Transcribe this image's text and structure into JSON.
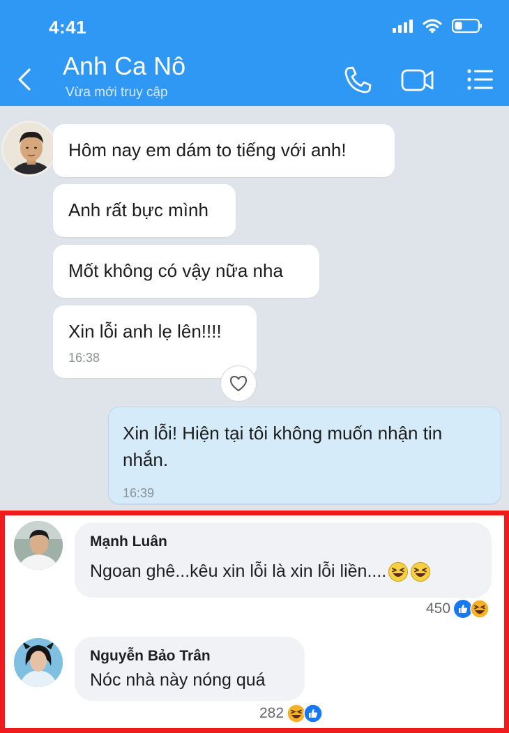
{
  "status_bar": {
    "time": "4:41"
  },
  "header": {
    "title": "Anh Ca Nô",
    "subtitle": "Vừa mới truy cập"
  },
  "messages": [
    {
      "from": "contact",
      "text": "Hôm nay em dám to tiếng với anh!"
    },
    {
      "from": "contact",
      "text": "Anh rất bực mình"
    },
    {
      "from": "contact",
      "text": "Mốt không có vậy nữa nha"
    },
    {
      "from": "contact",
      "text": "Xin lỗi anh lẹ lên!!!!",
      "time": "16:38"
    },
    {
      "from": "me",
      "text": "Xin lỗi! Hiện tại tôi không muốn nhận tin nhắn.",
      "time": "16:39"
    }
  ],
  "comments": [
    {
      "name": "Mạnh Luân",
      "text": "Ngoan ghê...kêu xin lỗi là xin lỗi liền....",
      "reaction_count": "450",
      "reactions": [
        "like-icon",
        "haha-icon"
      ]
    },
    {
      "name": "Nguyễn Bảo Trân",
      "text": "Nóc nhà này nóng quá",
      "reaction_count": "282",
      "reactions": [
        "haha-icon",
        "like-icon"
      ]
    }
  ],
  "colors": {
    "header_blue": "#2f98f5",
    "chat_background": "#dfe3ea",
    "sent_bubble": "#d6ebfa",
    "highlight_border": "#ee1c1c",
    "comment_bubble": "#f0f2f5"
  }
}
